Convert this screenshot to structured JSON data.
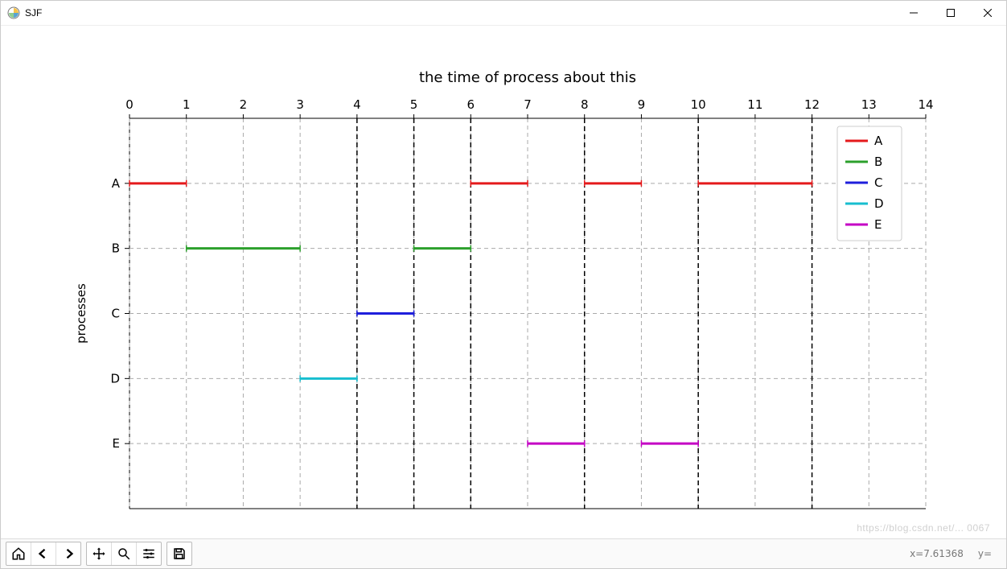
{
  "window": {
    "title": "SJF"
  },
  "toolbar": {
    "home_tip": "Home",
    "back_tip": "Back",
    "forward_tip": "Forward",
    "pan_tip": "Pan",
    "zoom_tip": "Zoom",
    "config_tip": "Configure",
    "save_tip": "Save"
  },
  "status": {
    "x_label": "x=7.61368",
    "y_label": "y="
  },
  "watermark": "https://blog.csdn.net/... 0067",
  "chart_data": {
    "type": "line",
    "title": "the time of process about this",
    "xlabel": "",
    "ylabel": "processes",
    "xlim": [
      0,
      14
    ],
    "x_ticks": [
      0,
      1,
      2,
      3,
      4,
      5,
      6,
      7,
      8,
      9,
      10,
      11,
      12,
      13,
      14
    ],
    "categories": [
      "A",
      "B",
      "C",
      "D",
      "E"
    ],
    "vlines": [
      4,
      5,
      6,
      8,
      10,
      12
    ],
    "legend": [
      "A",
      "B",
      "C",
      "D",
      "E"
    ],
    "colors": {
      "A": "#e41a1c",
      "B": "#2ca02c",
      "C": "#1f1fdc",
      "D": "#17becf",
      "E": "#c400c4"
    },
    "series": [
      {
        "name": "A",
        "y": "A",
        "segments": [
          [
            0,
            1
          ],
          [
            6,
            7
          ],
          [
            8,
            9
          ],
          [
            10,
            12
          ]
        ]
      },
      {
        "name": "B",
        "y": "B",
        "segments": [
          [
            1,
            3
          ],
          [
            5,
            6
          ]
        ]
      },
      {
        "name": "C",
        "y": "C",
        "segments": [
          [
            4,
            5
          ]
        ]
      },
      {
        "name": "D",
        "y": "D",
        "segments": [
          [
            3,
            4
          ]
        ]
      },
      {
        "name": "E",
        "y": "E",
        "segments": [
          [
            7,
            8
          ],
          [
            9,
            10
          ]
        ]
      }
    ]
  }
}
